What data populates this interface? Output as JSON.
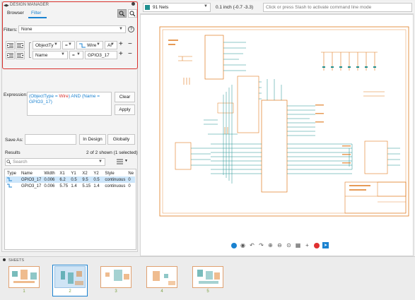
{
  "panel": {
    "title": "DESIGN MANAGER",
    "tabs": [
      "Browser",
      "Filter"
    ],
    "filters_label": "Filters:",
    "filters_value": "None",
    "help_glyph": "?",
    "row1": {
      "field": "ObjectTy",
      "op": "=",
      "value": "Wire",
      "conj": "Al"
    },
    "row2": {
      "field": "Name",
      "op": "=",
      "value": "GPIO3_17"
    },
    "plus": "+",
    "minus": "−",
    "expression_label": "Expression:",
    "expression": {
      "p1": "(ObjectType = ",
      "p2": "Wire",
      "p3": ") AND (Name = ",
      "p4": "GPIO3_17)"
    },
    "clear_label": "Clear",
    "apply_label": "Apply",
    "save_as_label": "Save As:",
    "in_design_label": "In Design",
    "globally_label": "Globally",
    "results_label": "Results",
    "results_count": "2 of 2 shown (1 selected)",
    "search_placeholder": "Search",
    "columns": [
      "Type",
      "Name",
      "Width",
      "X1",
      "Y1",
      "X2",
      "Y2",
      "Style",
      "Ne"
    ],
    "rows": [
      {
        "name": "GPIO3_17",
        "width": "0.006",
        "x1": "6.2",
        "y1": "0.5",
        "x2": "9.5",
        "y2": "0.5",
        "style": "continuous",
        "net": "0"
      },
      {
        "name": "GPIO3_17",
        "width": "0.006",
        "x1": "5.75",
        "y1": "1.4",
        "x2": "5.15",
        "y2": "1.4",
        "style": "continuous",
        "net": "0"
      }
    ]
  },
  "toolbar": {
    "nets_value": "91 Nets",
    "coords": "0.1 inch (-0.7 -3.3)",
    "command_placeholder": "Click or press Slash to activate command line mode"
  },
  "sheets": {
    "title": "SHEETS",
    "numbers": [
      "1",
      "2",
      "3",
      "4",
      "5"
    ],
    "selected": 2
  },
  "colors": {
    "accent": "#1a82d0",
    "schematic_orange": "#e07a1f",
    "wire_teal": "#1f8f8f",
    "annotation": "#d9302c",
    "selected_row": "#cde6fa"
  }
}
